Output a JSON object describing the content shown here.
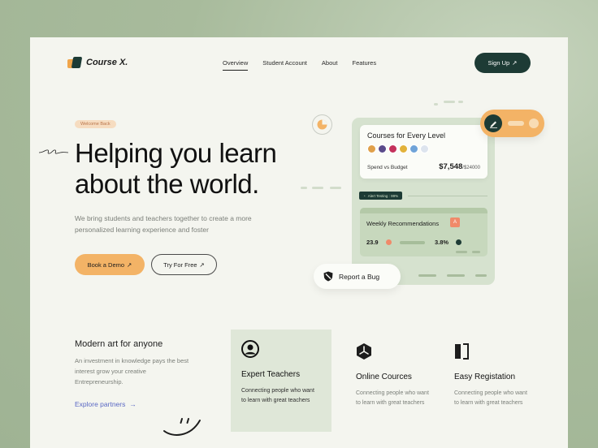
{
  "brand": {
    "name": "Course X.",
    "colors": {
      "dark": "#1d3b35",
      "accent": "#f3b366",
      "card": "#f4f5ef",
      "link": "#5a68c4"
    }
  },
  "nav": {
    "items": [
      "Overview",
      "Student Account",
      "About",
      "Features"
    ],
    "active": "Overview"
  },
  "signup": {
    "label": "Sign Up",
    "icon": "arrow-up-right-icon"
  },
  "hero": {
    "badge": "Welcome Back",
    "headline_line1": "Helping you learn",
    "headline_line2": "about the world.",
    "subtitle": "We bring students and teachers together to create a more personalized learning experience and foster",
    "primary_button": "Book a Demo",
    "secondary_button": "Try For Free"
  },
  "mockup": {
    "courses_title": "Courses for Every Level",
    "spend_label": "Spend vs Budget",
    "spend_value": "$7,548",
    "budget_value": "/$24000",
    "alert_text": "Alert Testing : 99%",
    "weekly_title": "Weekly Recommendations",
    "weekly_badge": "A",
    "stat1": "23.9",
    "stat2": "3.8%",
    "report_label": "Report a Bug",
    "toggle_icon": "pencil-icon"
  },
  "modern": {
    "title": "Modern art for anyone",
    "description": "An investment in knowledge pays the best interest grow your creative Entrepreneurship.",
    "link": "Explore partners"
  },
  "features": [
    {
      "title": "Expert Teachers",
      "description": "Connecting people who want to learn with great teachers",
      "icon": "person-icon"
    },
    {
      "title": "Online Cources",
      "description": "Connecting people who want to learn with great teachers",
      "icon": "triad-icon"
    },
    {
      "title": "Easy Registation",
      "description": "Connecting people who want to learn with great teachers",
      "icon": "bracket-icon"
    }
  ]
}
